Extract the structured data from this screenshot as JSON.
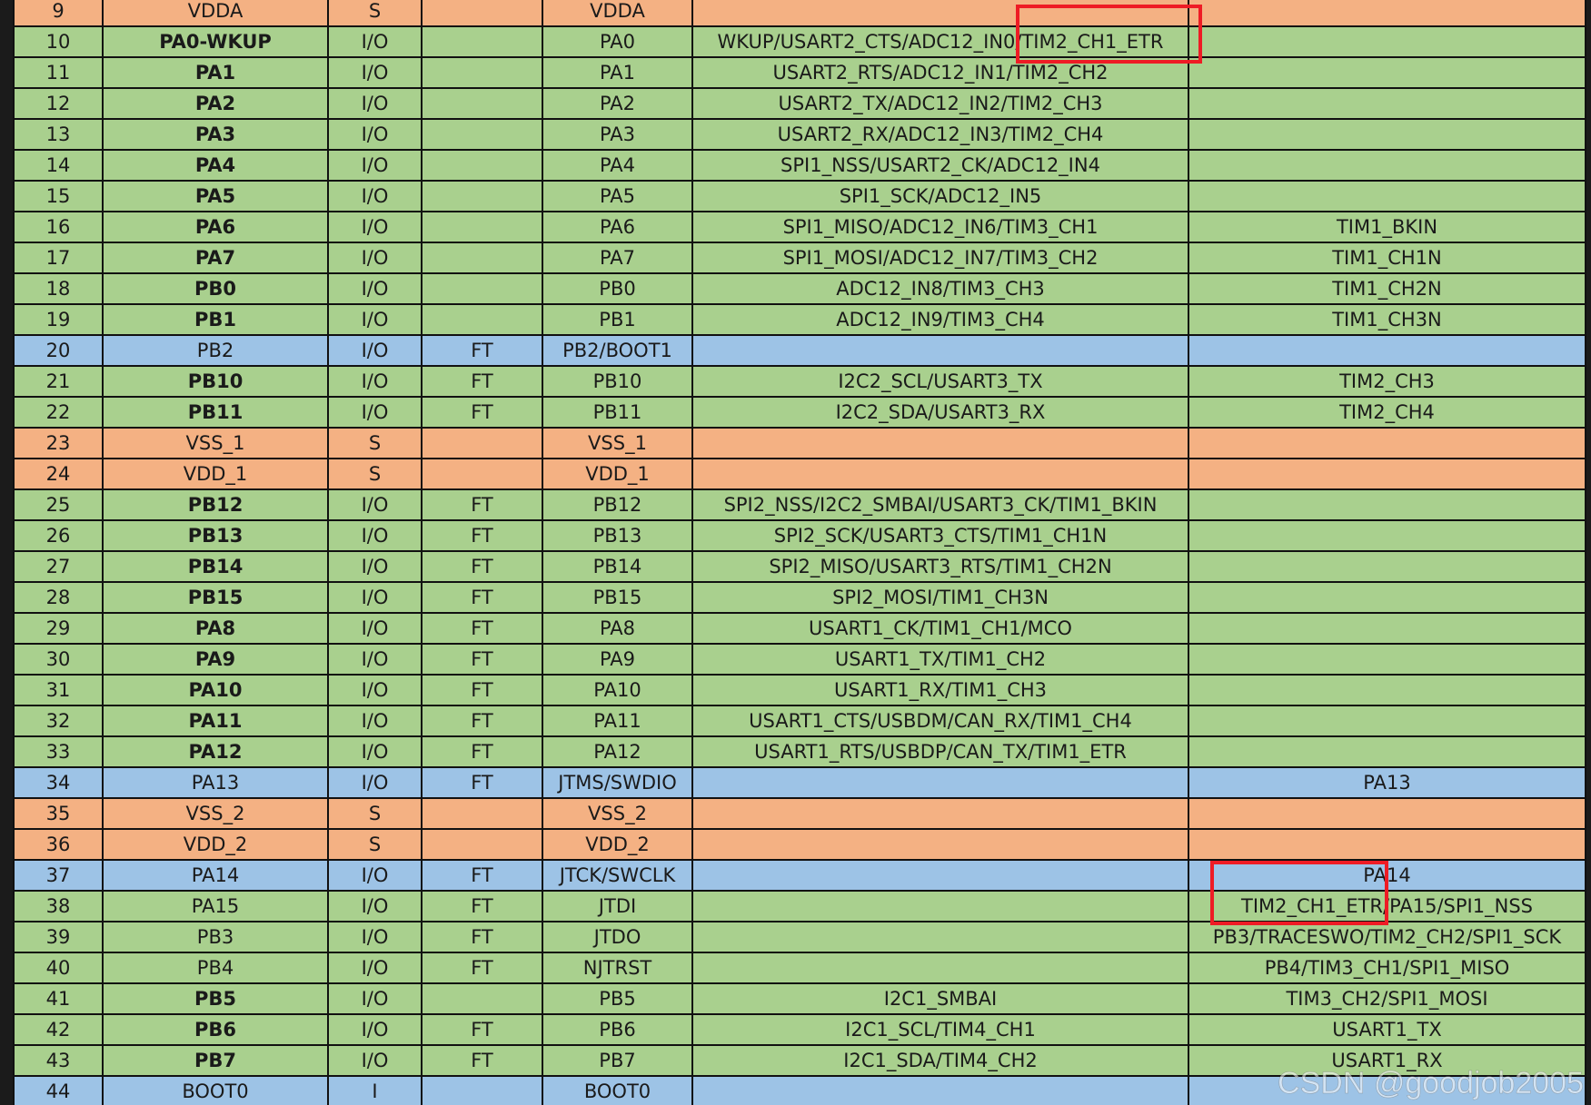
{
  "table": {
    "rows": [
      {
        "pin": "9",
        "name": "VDDA",
        "bold": false,
        "type": "S",
        "io_level": "",
        "main_function": "VDDA",
        "default_alternate": "",
        "remap": "",
        "kind": "power"
      },
      {
        "pin": "10",
        "name": "PA0-WKUP",
        "bold": true,
        "type": "I/O",
        "io_level": "",
        "main_function": "PA0",
        "default_alternate": "WKUP/USART2_CTS/ADC12_IN0/TIM2_CH1_ETR",
        "remap": "",
        "kind": "io"
      },
      {
        "pin": "11",
        "name": "PA1",
        "bold": true,
        "type": "I/O",
        "io_level": "",
        "main_function": "PA1",
        "default_alternate": "USART2_RTS/ADC12_IN1/TIM2_CH2",
        "remap": "",
        "kind": "io"
      },
      {
        "pin": "12",
        "name": "PA2",
        "bold": true,
        "type": "I/O",
        "io_level": "",
        "main_function": "PA2",
        "default_alternate": "USART2_TX/ADC12_IN2/TIM2_CH3",
        "remap": "",
        "kind": "io"
      },
      {
        "pin": "13",
        "name": "PA3",
        "bold": true,
        "type": "I/O",
        "io_level": "",
        "main_function": "PA3",
        "default_alternate": "USART2_RX/ADC12_IN3/TIM2_CH4",
        "remap": "",
        "kind": "io"
      },
      {
        "pin": "14",
        "name": "PA4",
        "bold": true,
        "type": "I/O",
        "io_level": "",
        "main_function": "PA4",
        "default_alternate": "SPI1_NSS/USART2_CK/ADC12_IN4",
        "remap": "",
        "kind": "io"
      },
      {
        "pin": "15",
        "name": "PA5",
        "bold": true,
        "type": "I/O",
        "io_level": "",
        "main_function": "PA5",
        "default_alternate": "SPI1_SCK/ADC12_IN5",
        "remap": "",
        "kind": "io"
      },
      {
        "pin": "16",
        "name": "PA6",
        "bold": true,
        "type": "I/O",
        "io_level": "",
        "main_function": "PA6",
        "default_alternate": "SPI1_MISO/ADC12_IN6/TIM3_CH1",
        "remap": "TIM1_BKIN",
        "kind": "io"
      },
      {
        "pin": "17",
        "name": "PA7",
        "bold": true,
        "type": "I/O",
        "io_level": "",
        "main_function": "PA7",
        "default_alternate": "SPI1_MOSI/ADC12_IN7/TIM3_CH2",
        "remap": "TIM1_CH1N",
        "kind": "io"
      },
      {
        "pin": "18",
        "name": "PB0",
        "bold": true,
        "type": "I/O",
        "io_level": "",
        "main_function": "PB0",
        "default_alternate": "ADC12_IN8/TIM3_CH3",
        "remap": "TIM1_CH2N",
        "kind": "io"
      },
      {
        "pin": "19",
        "name": "PB1",
        "bold": true,
        "type": "I/O",
        "io_level": "",
        "main_function": "PB1",
        "default_alternate": "ADC12_IN9/TIM3_CH4",
        "remap": "TIM1_CH3N",
        "kind": "io"
      },
      {
        "pin": "20",
        "name": "PB2",
        "bold": false,
        "type": "I/O",
        "io_level": "FT",
        "main_function": "PB2/BOOT1",
        "default_alternate": "",
        "remap": "",
        "kind": "special"
      },
      {
        "pin": "21",
        "name": "PB10",
        "bold": true,
        "type": "I/O",
        "io_level": "FT",
        "main_function": "PB10",
        "default_alternate": "I2C2_SCL/USART3_TX",
        "remap": "TIM2_CH3",
        "kind": "io"
      },
      {
        "pin": "22",
        "name": "PB11",
        "bold": true,
        "type": "I/O",
        "io_level": "FT",
        "main_function": "PB11",
        "default_alternate": "I2C2_SDA/USART3_RX",
        "remap": "TIM2_CH4",
        "kind": "io"
      },
      {
        "pin": "23",
        "name": "VSS_1",
        "bold": false,
        "type": "S",
        "io_level": "",
        "main_function": "VSS_1",
        "default_alternate": "",
        "remap": "",
        "kind": "power"
      },
      {
        "pin": "24",
        "name": "VDD_1",
        "bold": false,
        "type": "S",
        "io_level": "",
        "main_function": "VDD_1",
        "default_alternate": "",
        "remap": "",
        "kind": "power"
      },
      {
        "pin": "25",
        "name": "PB12",
        "bold": true,
        "type": "I/O",
        "io_level": "FT",
        "main_function": "PB12",
        "default_alternate": "SPI2_NSS/I2C2_SMBAI/USART3_CK/TIM1_BKIN",
        "remap": "",
        "kind": "io"
      },
      {
        "pin": "26",
        "name": "PB13",
        "bold": true,
        "type": "I/O",
        "io_level": "FT",
        "main_function": "PB13",
        "default_alternate": "SPI2_SCK/USART3_CTS/TIM1_CH1N",
        "remap": "",
        "kind": "io"
      },
      {
        "pin": "27",
        "name": "PB14",
        "bold": true,
        "type": "I/O",
        "io_level": "FT",
        "main_function": "PB14",
        "default_alternate": "SPI2_MISO/USART3_RTS/TIM1_CH2N",
        "remap": "",
        "kind": "io"
      },
      {
        "pin": "28",
        "name": "PB15",
        "bold": true,
        "type": "I/O",
        "io_level": "FT",
        "main_function": "PB15",
        "default_alternate": "SPI2_MOSI/TIM1_CH3N",
        "remap": "",
        "kind": "io"
      },
      {
        "pin": "29",
        "name": "PA8",
        "bold": true,
        "type": "I/O",
        "io_level": "FT",
        "main_function": "PA8",
        "default_alternate": "USART1_CK/TIM1_CH1/MCO",
        "remap": "",
        "kind": "io"
      },
      {
        "pin": "30",
        "name": "PA9",
        "bold": true,
        "type": "I/O",
        "io_level": "FT",
        "main_function": "PA9",
        "default_alternate": "USART1_TX/TIM1_CH2",
        "remap": "",
        "kind": "io"
      },
      {
        "pin": "31",
        "name": "PA10",
        "bold": true,
        "type": "I/O",
        "io_level": "FT",
        "main_function": "PA10",
        "default_alternate": "USART1_RX/TIM1_CH3",
        "remap": "",
        "kind": "io"
      },
      {
        "pin": "32",
        "name": "PA11",
        "bold": true,
        "type": "I/O",
        "io_level": "FT",
        "main_function": "PA11",
        "default_alternate": "USART1_CTS/USBDM/CAN_RX/TIM1_CH4",
        "remap": "",
        "kind": "io"
      },
      {
        "pin": "33",
        "name": "PA12",
        "bold": true,
        "type": "I/O",
        "io_level": "FT",
        "main_function": "PA12",
        "default_alternate": "USART1_RTS/USBDP/CAN_TX/TIM1_ETR",
        "remap": "",
        "kind": "io"
      },
      {
        "pin": "34",
        "name": "PA13",
        "bold": false,
        "type": "I/O",
        "io_level": "FT",
        "main_function": "JTMS/SWDIO",
        "default_alternate": "",
        "remap": "PA13",
        "kind": "special"
      },
      {
        "pin": "35",
        "name": "VSS_2",
        "bold": false,
        "type": "S",
        "io_level": "",
        "main_function": "VSS_2",
        "default_alternate": "",
        "remap": "",
        "kind": "power"
      },
      {
        "pin": "36",
        "name": "VDD_2",
        "bold": false,
        "type": "S",
        "io_level": "",
        "main_function": "VDD_2",
        "default_alternate": "",
        "remap": "",
        "kind": "power"
      },
      {
        "pin": "37",
        "name": "PA14",
        "bold": false,
        "type": "I/O",
        "io_level": "FT",
        "main_function": "JTCK/SWCLK",
        "default_alternate": "",
        "remap": "PA14",
        "kind": "special"
      },
      {
        "pin": "38",
        "name": "PA15",
        "bold": false,
        "type": "I/O",
        "io_level": "FT",
        "main_function": "JTDI",
        "default_alternate": "",
        "remap": "TIM2_CH1_ETR/PA15/SPI1_NSS",
        "kind": "io"
      },
      {
        "pin": "39",
        "name": "PB3",
        "bold": false,
        "type": "I/O",
        "io_level": "FT",
        "main_function": "JTDO",
        "default_alternate": "",
        "remap": "PB3/TRACESWO/TIM2_CH2/SPI1_SCK",
        "kind": "io"
      },
      {
        "pin": "40",
        "name": "PB4",
        "bold": false,
        "type": "I/O",
        "io_level": "FT",
        "main_function": "NJTRST",
        "default_alternate": "",
        "remap": "PB4/TIM3_CH1/SPI1_MISO",
        "kind": "io"
      },
      {
        "pin": "41",
        "name": "PB5",
        "bold": true,
        "type": "I/O",
        "io_level": "",
        "main_function": "PB5",
        "default_alternate": "I2C1_SMBAI",
        "remap": "TIM3_CH2/SPI1_MOSI",
        "kind": "io"
      },
      {
        "pin": "42",
        "name": "PB6",
        "bold": true,
        "type": "I/O",
        "io_level": "FT",
        "main_function": "PB6",
        "default_alternate": "I2C1_SCL/TIM4_CH1",
        "remap": "USART1_TX",
        "kind": "io"
      },
      {
        "pin": "43",
        "name": "PB7",
        "bold": true,
        "type": "I/O",
        "io_level": "FT",
        "main_function": "PB7",
        "default_alternate": "I2C1_SDA/TIM4_CH2",
        "remap": "USART1_RX",
        "kind": "io"
      },
      {
        "pin": "44",
        "name": "BOOT0",
        "bold": false,
        "type": "I",
        "io_level": "",
        "main_function": "BOOT0",
        "default_alternate": "",
        "remap": "",
        "kind": "special"
      }
    ]
  },
  "colors": {
    "power_row": "#f4b183",
    "io_row": "#a9d08e",
    "special_row": "#9dc3e6",
    "highlight_box": "#ee1c25"
  },
  "annotations": [
    {
      "label": "highlight-default-alt-tim2-ch1-etr"
    },
    {
      "label": "highlight-remap-tim2-ch1-etr"
    }
  ],
  "watermark": "CSDN @goodjob2005"
}
